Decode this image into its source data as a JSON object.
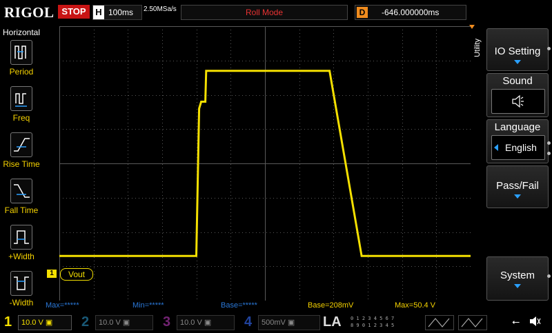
{
  "header": {
    "brand": "RIGOL",
    "run_state": "STOP",
    "timebase_label": "H",
    "timebase_value": "100ms",
    "sample_rate": "2.50MSa/s",
    "mode": "Roll Mode",
    "delay_label": "D",
    "delay_value": "-646.000000ms"
  },
  "left_menu": {
    "title": "Horizontal",
    "items": [
      {
        "label": "Period",
        "icon": "period-icon"
      },
      {
        "label": "Freq",
        "icon": "frequency-icon"
      },
      {
        "label": "Rise Time",
        "icon": "rise-time-icon"
      },
      {
        "label": "Fall Time",
        "icon": "fall-time-icon"
      },
      {
        "label": "+Width",
        "icon": "positive-width-icon"
      },
      {
        "label": "-Width",
        "icon": "negative-width-icon"
      }
    ]
  },
  "right_menu": {
    "tab_label": "Utility",
    "io_setting": "IO Setting",
    "sound": "Sound",
    "language": "Language",
    "language_value": "English",
    "pass_fail": "Pass/Fail",
    "system": "System"
  },
  "trace": {
    "channel_marker": "1",
    "label": "Vout",
    "color": "#f5e000",
    "waveform": {
      "baseline_div": -2.7,
      "high_div": 2.7,
      "points_div": [
        [
          -5,
          -2.7
        ],
        [
          -1.67,
          -2.7
        ],
        [
          -1.6,
          1.6
        ],
        [
          -1.55,
          1.8
        ],
        [
          -1.45,
          1.8
        ],
        [
          -1.43,
          2.7
        ],
        [
          1.57,
          2.7
        ],
        [
          2.35,
          -2.7
        ],
        [
          5,
          -2.7
        ]
      ]
    }
  },
  "measurements": [
    {
      "label": "Max=",
      "value": "*****"
    },
    {
      "label": "Min=",
      "value": "*****"
    },
    {
      "label": "Base=",
      "value": "*****"
    },
    {
      "label": "Base=",
      "value": "208mV"
    },
    {
      "label": "Max=",
      "value": "50.4 V"
    }
  ],
  "channels": [
    {
      "num": "1",
      "scale": "10.0 V",
      "color": "#f5e000"
    },
    {
      "num": "2",
      "scale": "10.0 V",
      "color": "#2ea0d8"
    },
    {
      "num": "3",
      "scale": "10.0 V",
      "color": "#d040d0"
    },
    {
      "num": "4",
      "scale": "500mV",
      "color": "#3060e0"
    }
  ],
  "logic_analyzer": {
    "label": "LA",
    "rows": [
      "0 1 2 3   4 5 6 7",
      "8 9 0 1   2 3 4 5"
    ]
  },
  "colors": {
    "grid": "#5a5a5a",
    "trigger": "#f08c1e",
    "accent": "#2aa0ff"
  }
}
